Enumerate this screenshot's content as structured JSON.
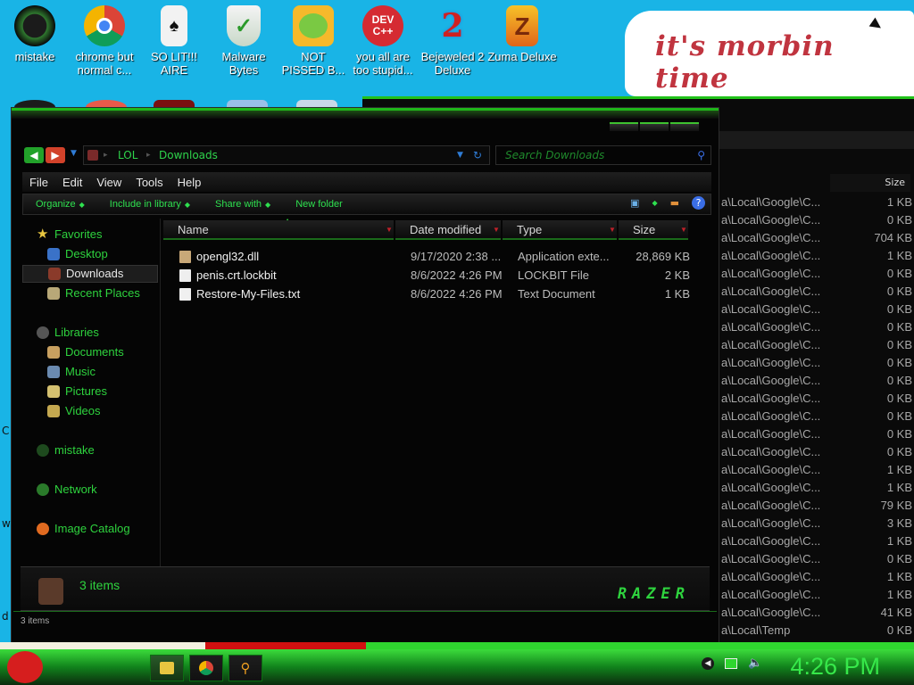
{
  "desktop": {
    "icons": [
      {
        "label": "mistake",
        "color": "#1c6a2a"
      },
      {
        "label": "chrome but normal c...",
        "color": "#e0e0e0"
      },
      {
        "label": "SO LIT!!! AIRE",
        "color": "#f2f2f2"
      },
      {
        "label": "Malware Bytes",
        "color": "#e0f0e0"
      },
      {
        "label": "NOT PISSED B...",
        "color": "#f6b92b"
      },
      {
        "label": "you all are too stupid...",
        "color": "#d52b32"
      },
      {
        "label": "Bejeweled 2 Deluxe",
        "color": "#3b74d0"
      },
      {
        "label": "Zuma Deluxe",
        "color": "#f09c16"
      }
    ],
    "note_text": "it's morbin time",
    "stray_letters": [
      "C",
      "w",
      "d"
    ]
  },
  "background_window": {
    "size_header": "Size",
    "rows": [
      {
        "path": "a\\Local\\Google\\C...",
        "size": "1 KB"
      },
      {
        "path": "a\\Local\\Google\\C...",
        "size": "0 KB"
      },
      {
        "path": "a\\Local\\Google\\C...",
        "size": "704 KB"
      },
      {
        "path": "a\\Local\\Google\\C...",
        "size": "1 KB"
      },
      {
        "path": "a\\Local\\Google\\C...",
        "size": "0 KB"
      },
      {
        "path": "a\\Local\\Google\\C...",
        "size": "0 KB"
      },
      {
        "path": "a\\Local\\Google\\C...",
        "size": "0 KB"
      },
      {
        "path": "a\\Local\\Google\\C...",
        "size": "0 KB"
      },
      {
        "path": "a\\Local\\Google\\C...",
        "size": "0 KB"
      },
      {
        "path": "a\\Local\\Google\\C...",
        "size": "0 KB"
      },
      {
        "path": "a\\Local\\Google\\C...",
        "size": "0 KB"
      },
      {
        "path": "a\\Local\\Google\\C...",
        "size": "0 KB"
      },
      {
        "path": "a\\Local\\Google\\C...",
        "size": "0 KB"
      },
      {
        "path": "a\\Local\\Google\\C...",
        "size": "0 KB"
      },
      {
        "path": "a\\Local\\Google\\C...",
        "size": "0 KB"
      },
      {
        "path": "a\\Local\\Google\\C...",
        "size": "1 KB"
      },
      {
        "path": "a\\Local\\Google\\C...",
        "size": "1 KB"
      },
      {
        "path": "a\\Local\\Google\\C...",
        "size": "79 KB"
      },
      {
        "path": "a\\Local\\Google\\C...",
        "size": "3 KB"
      },
      {
        "path": "a\\Local\\Google\\C...",
        "size": "1 KB"
      },
      {
        "path": "a\\Local\\Google\\C...",
        "size": "0 KB"
      },
      {
        "path": "a\\Local\\Google\\C...",
        "size": "1 KB"
      },
      {
        "path": "a\\Local\\Google\\C...",
        "size": "1 KB"
      },
      {
        "path": "a\\Local\\Google\\C...",
        "size": "41 KB"
      },
      {
        "path": "a\\Local\\Temp",
        "size": "0 KB"
      }
    ]
  },
  "explorer": {
    "address": {
      "segment1": "LOL",
      "segment2": "Downloads"
    },
    "search_placeholder": "Search Downloads",
    "menu": [
      "File",
      "Edit",
      "View",
      "Tools",
      "Help"
    ],
    "commands": [
      "Organize",
      "Include in library",
      "Share with",
      "New folder"
    ],
    "nav": {
      "favorites": "Favorites",
      "desktop": "Desktop",
      "downloads": "Downloads",
      "recent": "Recent Places",
      "libraries": "Libraries",
      "documents": "Documents",
      "music": "Music",
      "pictures": "Pictures",
      "videos": "Videos",
      "mistake": "mistake",
      "network": "Network",
      "image_catalog": "Image Catalog"
    },
    "columns": {
      "name": "Name",
      "date": "Date modified",
      "type": "Type",
      "size": "Size"
    },
    "files": [
      {
        "name": "opengl32.dll",
        "date": "9/17/2020 2:38 ...",
        "type": "Application exte...",
        "size": "28,869 KB"
      },
      {
        "name": "penis.crt.lockbit",
        "date": "8/6/2022 4:26 PM",
        "type": "LOCKBIT File",
        "size": "2 KB"
      },
      {
        "name": "Restore-My-Files.txt",
        "date": "8/6/2022 4:26 PM",
        "type": "Text Document",
        "size": "1 KB"
      }
    ],
    "details_count": "3 items",
    "brand": "RAZER",
    "status": "3 items"
  },
  "taskbar": {
    "clock": "4:26 PM",
    "accent": "#2fd62f"
  }
}
